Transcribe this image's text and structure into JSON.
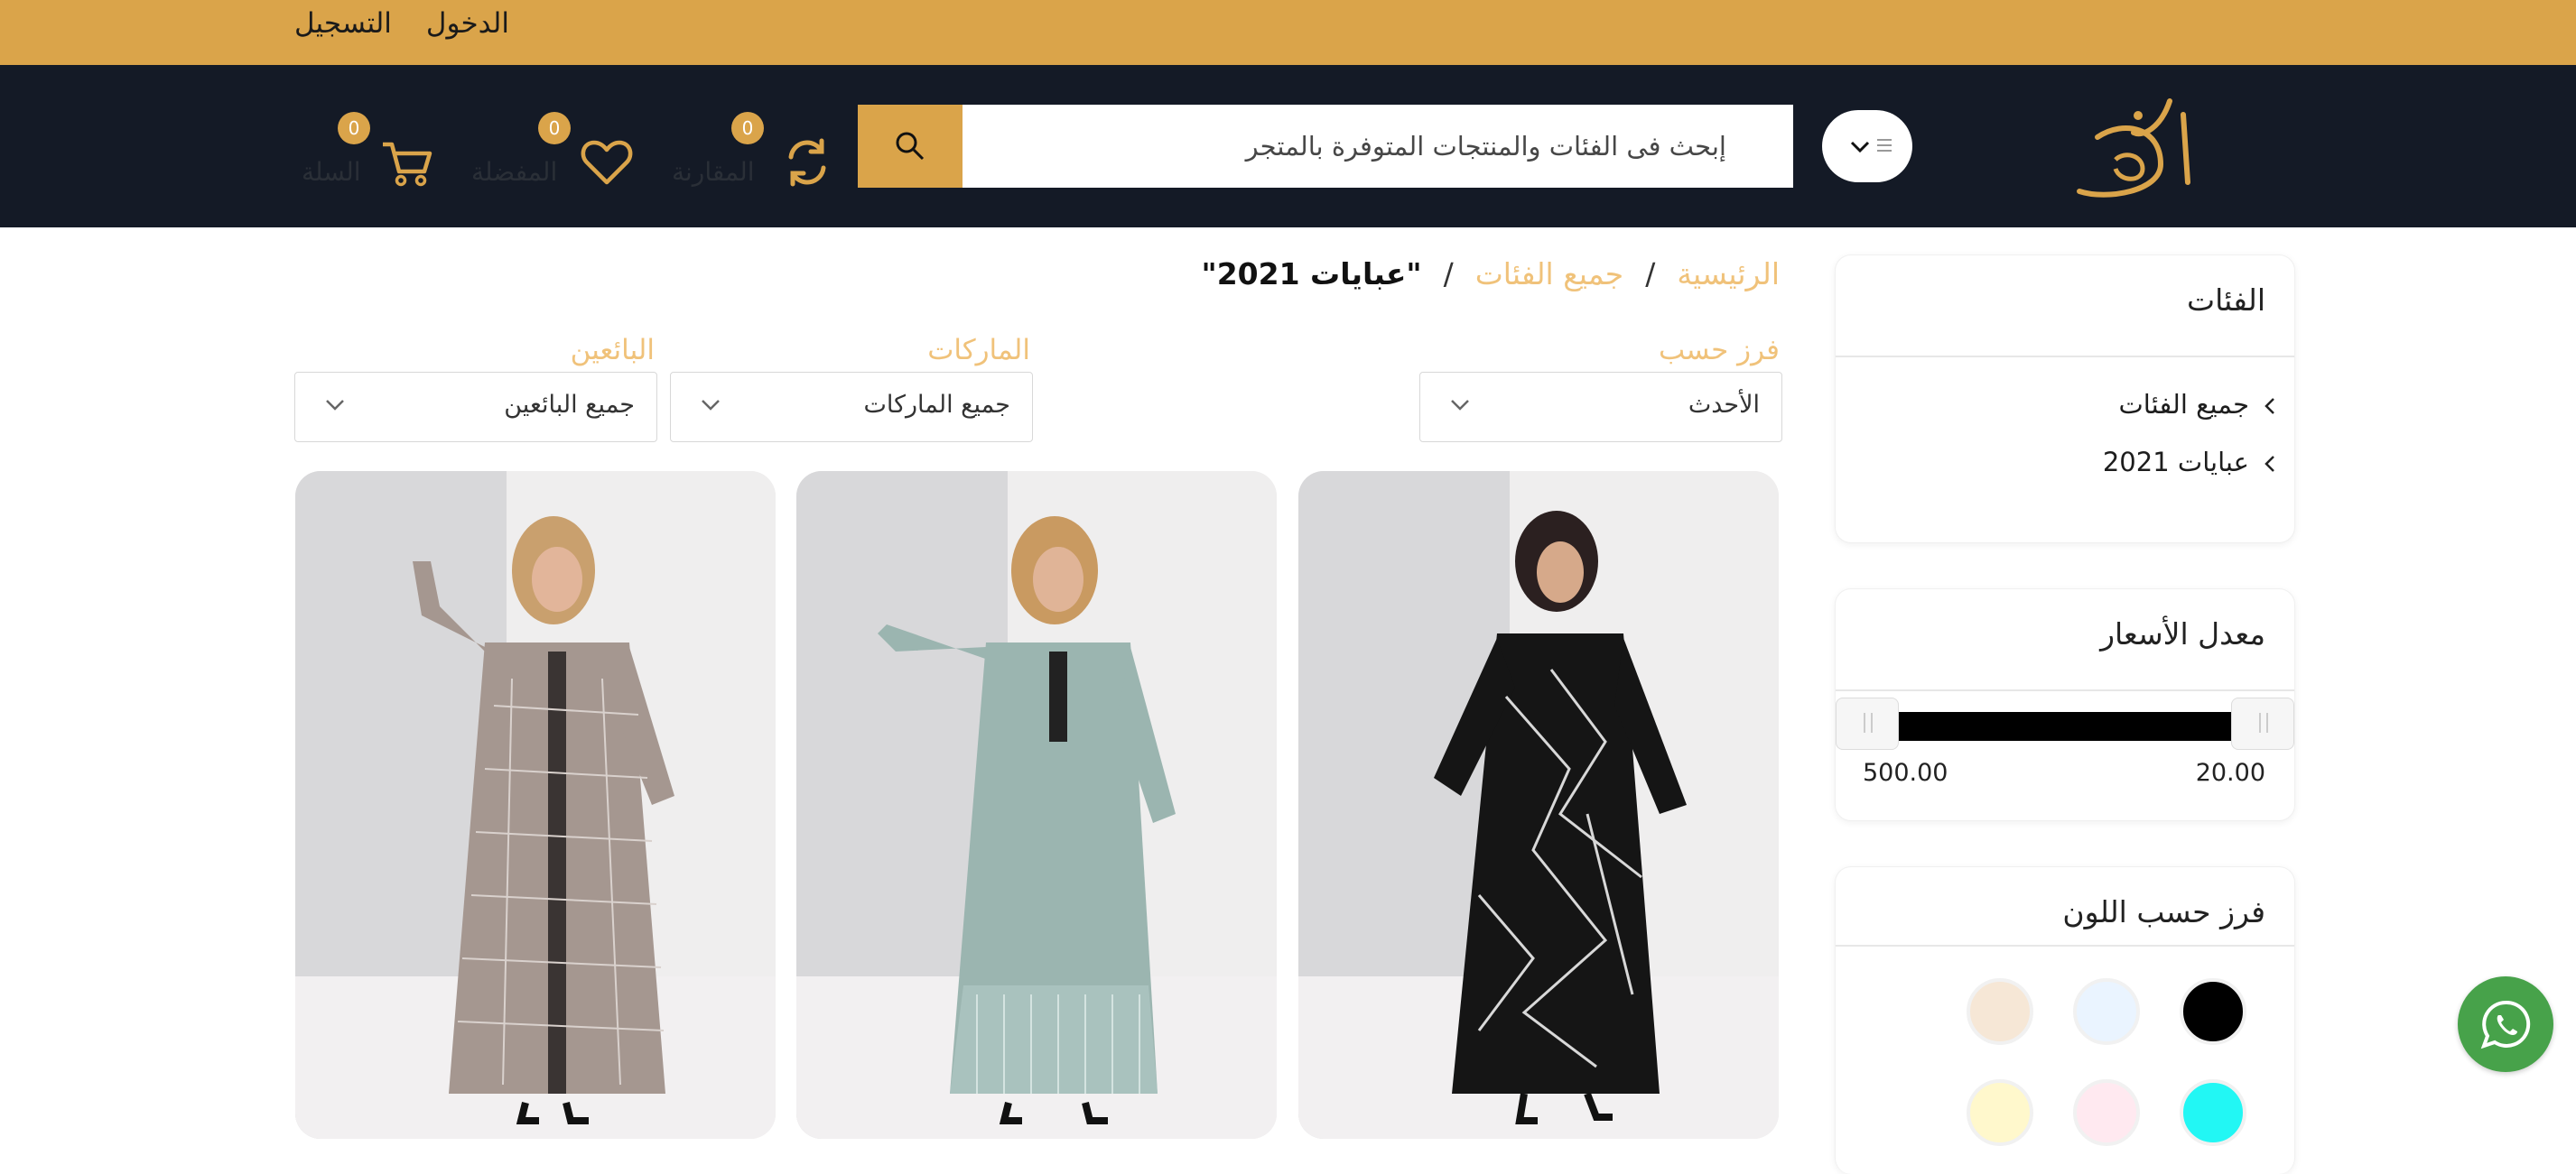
{
  "topbar": {
    "login": "الدخول",
    "register": "التسجيل"
  },
  "header": {
    "logo_icon": "brand-logo",
    "search_placeholder": "إبحث فى الفئات والمنتجات المتوفرة بالمتجر",
    "compare": {
      "label": "المقارنة",
      "count": "0",
      "icon": "refresh-icon"
    },
    "wishlist": {
      "label": "المفضلة",
      "count": "0",
      "icon": "heart-icon"
    },
    "cart": {
      "label": "السلة",
      "count": "0",
      "icon": "cart-icon"
    }
  },
  "sidebar": {
    "categories": {
      "title": "الفئات",
      "items": [
        "جميع الفئات",
        "عبايات 2021"
      ]
    },
    "price": {
      "title": "معدل الأسعار",
      "min": "20.00",
      "max": "500.00"
    },
    "colors": {
      "title": "فرز حسب اللون",
      "swatches": [
        "#000000",
        "#eaf4ff",
        "#f6e7d6",
        "#22f7f4",
        "#ffe9f0",
        "#fff8cc"
      ]
    }
  },
  "breadcrumb": {
    "home": "الرئيسية",
    "all": "جميع الفئات",
    "current": "\"عبايات 2021\""
  },
  "filters": {
    "sort": {
      "label": "فرز حسب",
      "value": "الأحدث"
    },
    "brands": {
      "label": "الماركات",
      "value": "جميع الماركات"
    },
    "sellers": {
      "label": "البائعين",
      "value": "جميع البائعين"
    }
  },
  "colors": {
    "gold": "#daa44a",
    "header_bg": "#141a26",
    "whatsapp": "#47a24a"
  }
}
